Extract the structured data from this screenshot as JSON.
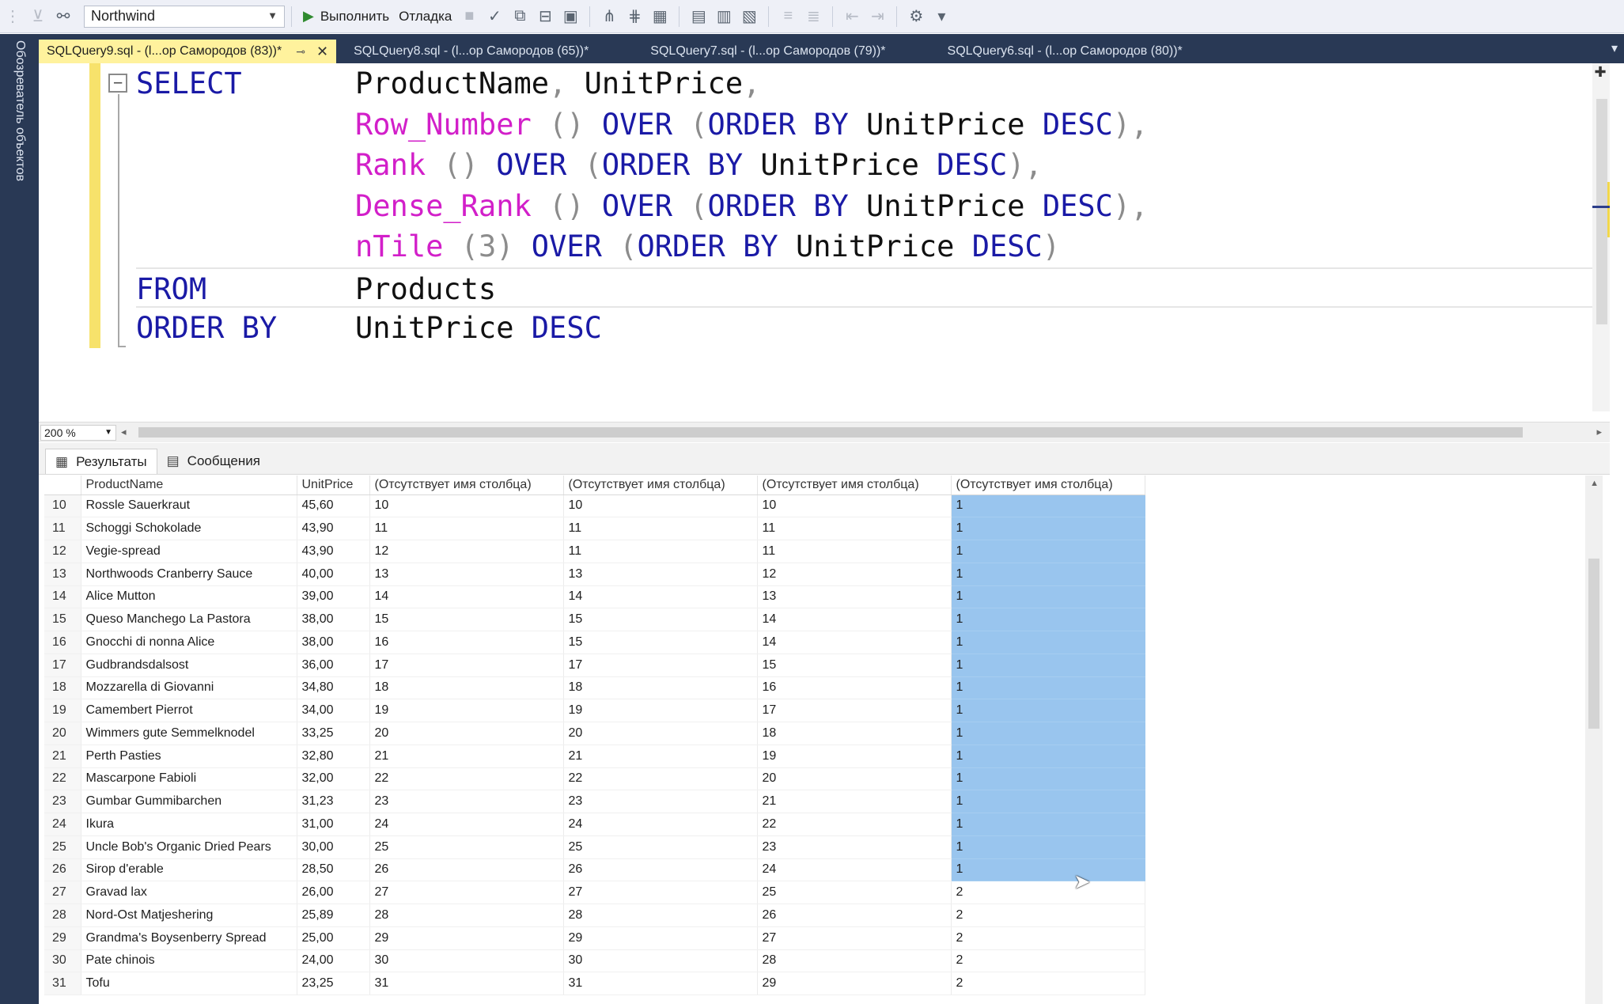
{
  "toolbar": {
    "database": "Northwind",
    "execute_label": "Выполнить",
    "debug_label": "Отладка"
  },
  "sidebar": {
    "label": "Обозреватель объектов"
  },
  "tabs": [
    {
      "label": "SQLQuery9.sql - (l...op Самородов (83))*",
      "active": true
    },
    {
      "label": "SQLQuery8.sql - (l...op Самородов (65))*"
    },
    {
      "label": "SQLQuery7.sql - (l...op Самородов (79))*"
    },
    {
      "label": "SQLQuery6.sql - (l...op Самородов (80))*"
    }
  ],
  "editor": {
    "lines": [
      {
        "kw": "SELECT",
        "rest": [
          [
            "id",
            "ProductName"
          ],
          [
            "pn",
            ", "
          ],
          [
            "id",
            "UnitPrice"
          ],
          [
            "pn",
            ","
          ]
        ]
      },
      {
        "kw": "",
        "rest": [
          [
            "fn",
            "Row_Number"
          ],
          [
            "pn",
            " () "
          ],
          [
            "kw",
            "OVER"
          ],
          [
            "pn",
            " ("
          ],
          [
            "kw",
            "ORDER BY"
          ],
          [
            "id",
            " UnitPrice "
          ],
          [
            "kw",
            "DESC"
          ],
          [
            "pn",
            "),"
          ]
        ]
      },
      {
        "kw": "",
        "rest": [
          [
            "fn",
            "Rank"
          ],
          [
            "pn",
            " () "
          ],
          [
            "kw",
            "OVER"
          ],
          [
            "pn",
            " ("
          ],
          [
            "kw",
            "ORDER BY"
          ],
          [
            "id",
            " UnitPrice "
          ],
          [
            "kw",
            "DESC"
          ],
          [
            "pn",
            "),"
          ]
        ]
      },
      {
        "kw": "",
        "rest": [
          [
            "fn",
            "Dense_Rank"
          ],
          [
            "pn",
            " () "
          ],
          [
            "kw",
            "OVER"
          ],
          [
            "pn",
            " ("
          ],
          [
            "kw",
            "ORDER BY"
          ],
          [
            "id",
            " UnitPrice "
          ],
          [
            "kw",
            "DESC"
          ],
          [
            "pn",
            "),"
          ]
        ]
      },
      {
        "kw": "",
        "rest": [
          [
            "fn",
            "nTile"
          ],
          [
            "pn",
            " (3) "
          ],
          [
            "kw",
            "OVER"
          ],
          [
            "pn",
            " ("
          ],
          [
            "kw",
            "ORDER BY"
          ],
          [
            "id",
            " UnitPrice "
          ],
          [
            "kw",
            "DESC"
          ],
          [
            "pn",
            ")"
          ]
        ]
      },
      {
        "kw": "FROM",
        "rest": [
          [
            "id",
            "Products"
          ]
        ]
      },
      {
        "kw": "ORDER BY",
        "rest": [
          [
            "id",
            "UnitPrice "
          ],
          [
            "kw",
            "DESC"
          ]
        ]
      }
    ]
  },
  "zoom": "200 %",
  "results": {
    "tabs": [
      "Результаты",
      "Сообщения"
    ],
    "columns": [
      "ProductName",
      "UnitPrice",
      "(Отсутствует имя столбца)",
      "(Отсутствует имя столбца)",
      "(Отсутствует имя столбца)",
      "(Отсутствует имя столбца)"
    ],
    "rows": [
      [
        "10",
        "Rossle Sauerkraut",
        "45,60",
        "10",
        "10",
        "10",
        "1"
      ],
      [
        "11",
        "Schoggi Schokolade",
        "43,90",
        "11",
        "11",
        "11",
        "1"
      ],
      [
        "12",
        "Vegie-spread",
        "43,90",
        "12",
        "11",
        "11",
        "1"
      ],
      [
        "13",
        "Northwoods Cranberry Sauce",
        "40,00",
        "13",
        "13",
        "12",
        "1"
      ],
      [
        "14",
        "Alice Mutton",
        "39,00",
        "14",
        "14",
        "13",
        "1"
      ],
      [
        "15",
        "Queso Manchego La Pastora",
        "38,00",
        "15",
        "15",
        "14",
        "1"
      ],
      [
        "16",
        "Gnocchi di nonna Alice",
        "38,00",
        "16",
        "15",
        "14",
        "1"
      ],
      [
        "17",
        "Gudbrandsdalsost",
        "36,00",
        "17",
        "17",
        "15",
        "1"
      ],
      [
        "18",
        "Mozzarella di Giovanni",
        "34,80",
        "18",
        "18",
        "16",
        "1"
      ],
      [
        "19",
        "Camembert Pierrot",
        "34,00",
        "19",
        "19",
        "17",
        "1"
      ],
      [
        "20",
        "Wimmers gute Semmelknodel",
        "33,25",
        "20",
        "20",
        "18",
        "1"
      ],
      [
        "21",
        "Perth Pasties",
        "32,80",
        "21",
        "21",
        "19",
        "1"
      ],
      [
        "22",
        "Mascarpone Fabioli",
        "32,00",
        "22",
        "22",
        "20",
        "1"
      ],
      [
        "23",
        "Gumbar Gummibarchen",
        "31,23",
        "23",
        "23",
        "21",
        "1"
      ],
      [
        "24",
        "Ikura",
        "31,00",
        "24",
        "24",
        "22",
        "1"
      ],
      [
        "25",
        "Uncle Bob's Organic Dried Pears",
        "30,00",
        "25",
        "25",
        "23",
        "1"
      ],
      [
        "26",
        "Sirop d'erable",
        "28,50",
        "26",
        "26",
        "24",
        "1"
      ],
      [
        "27",
        "Gravad lax",
        "26,00",
        "27",
        "27",
        "25",
        "2"
      ],
      [
        "28",
        "Nord-Ost Matjeshering",
        "25,89",
        "28",
        "28",
        "26",
        "2"
      ],
      [
        "29",
        "Grandma's Boysenberry Spread",
        "25,00",
        "29",
        "29",
        "27",
        "2"
      ],
      [
        "30",
        "Pate chinois",
        "24,00",
        "30",
        "30",
        "28",
        "2"
      ],
      [
        "31",
        "Tofu",
        "23,25",
        "31",
        "31",
        "29",
        "2"
      ]
    ],
    "selected_rows_last_col": 17,
    "selection_color": "#99c5ee"
  }
}
